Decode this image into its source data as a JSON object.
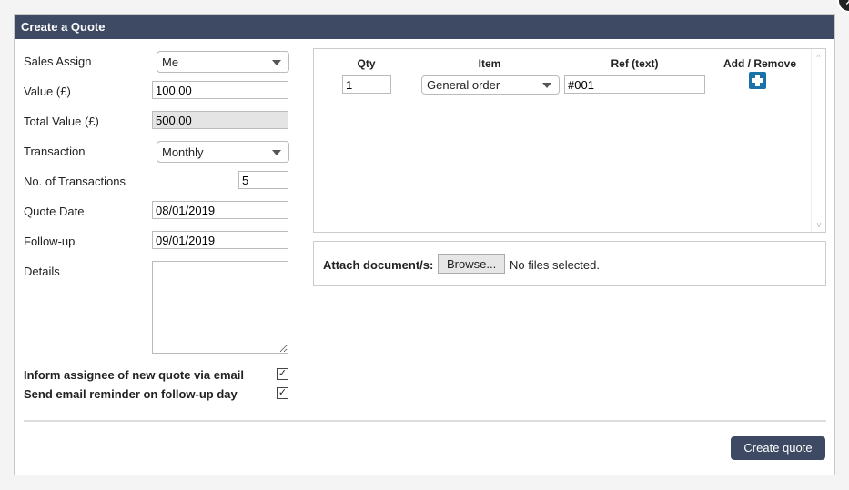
{
  "dialog": {
    "title": "Create a Quote",
    "close_icon": "close-icon"
  },
  "form": {
    "sales_assign_label": "Sales Assign",
    "sales_assign": "Me",
    "value_label": "Value (£)",
    "value": "100.00",
    "total_label": "Total Value (£)",
    "total": "500.00",
    "transaction_label": "Transaction",
    "transaction": "Monthly",
    "num_label": "No. of Transactions",
    "num": "5",
    "quote_date_label": "Quote Date",
    "quote_date": "08/01/2019",
    "followup_label": "Follow-up",
    "followup": "09/01/2019",
    "details_label": "Details",
    "details": "",
    "inform_label": "Inform assignee of new quote via email",
    "inform_checked": true,
    "reminder_label": "Send email reminder on follow-up day",
    "reminder_checked": true
  },
  "items": {
    "headers": [
      "Qty",
      "Item",
      "Ref (text)",
      "Add / Remove"
    ],
    "rows": [
      {
        "qty": "1",
        "item": "General order",
        "ref": "#001"
      }
    ]
  },
  "attach": {
    "label": "Attach document/s:",
    "browse": "Browse...",
    "status": "No files selected."
  },
  "submit": "Create quote"
}
